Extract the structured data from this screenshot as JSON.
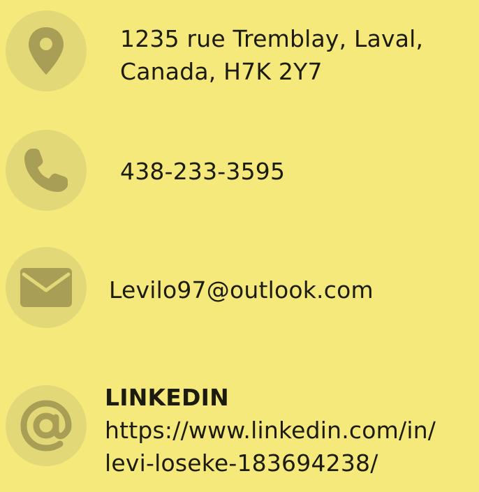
{
  "contact": {
    "address": {
      "icon": "location-pin-icon",
      "line1": "1235 rue Tremblay, Laval,",
      "line2": "Canada, H7K 2Y7"
    },
    "phone": {
      "icon": "phone-icon",
      "value": "438-233-3595"
    },
    "email": {
      "icon": "envelope-icon",
      "value": "Levilo97@outlook.com"
    },
    "linkedin": {
      "icon": "at-sign-icon",
      "label": "LINKEDIN",
      "url_line1": "https://www.linkedin.com/in/",
      "url_line2": "levi-loseke-183694238/"
    }
  },
  "colors": {
    "background": "#f4e97a",
    "icon_circle": "#e3d878",
    "icon_glyph": "#a89e55",
    "text": "#1c1b10"
  }
}
